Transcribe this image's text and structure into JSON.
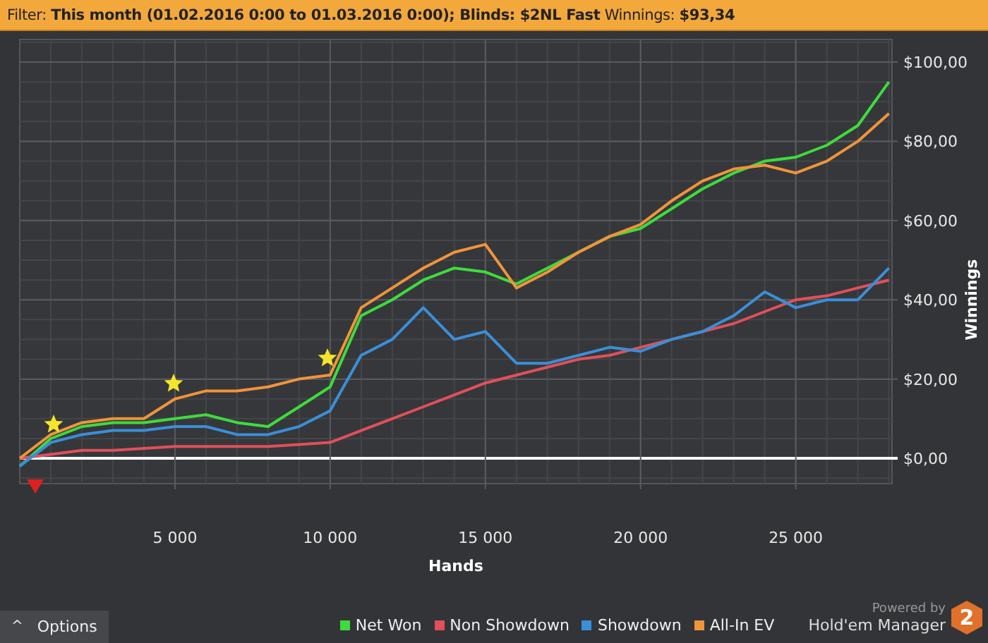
{
  "filter_bar": {
    "text": "Filter: **This month (01.02.2016 0:00 to 01.03.2016 0:00); Blinds: $2NL Fast** Winnings: **$93,34**"
  },
  "chart": {
    "chart_data": {
      "type": "line",
      "xlabel": "Hands",
      "ylabel": "Winnings",
      "x": [
        0,
        1000,
        2000,
        3000,
        4000,
        5000,
        6000,
        7000,
        8000,
        9000,
        10000,
        11000,
        12000,
        13000,
        14000,
        15000,
        16000,
        17000,
        18000,
        19000,
        20000,
        21000,
        22000,
        23000,
        24000,
        25000,
        26000,
        27000,
        28000
      ],
      "series": [
        {
          "name": "Net Won",
          "color": "#3ddc3d",
          "values": [
            -2,
            5,
            8,
            9,
            9,
            10,
            11,
            9,
            8,
            13,
            18,
            36,
            40,
            45,
            48,
            47,
            44,
            48,
            52,
            56,
            58,
            63,
            68,
            72,
            75,
            76,
            79,
            84,
            95
          ]
        },
        {
          "name": "Non Showdown",
          "color": "#e0505a",
          "values": [
            0,
            1,
            2,
            2,
            2.5,
            3,
            3,
            3,
            3,
            3.5,
            4,
            7,
            10,
            13,
            16,
            19,
            21,
            23,
            25,
            26,
            28,
            30,
            32,
            34,
            37,
            40,
            41,
            43,
            45
          ]
        },
        {
          "name": "Showdown",
          "color": "#3a8fd8",
          "values": [
            -2,
            4,
            6,
            7,
            7,
            8,
            8,
            6,
            6,
            8,
            12,
            26,
            30,
            38,
            30,
            32,
            24,
            24,
            26,
            28,
            27,
            30,
            32,
            36,
            42,
            38,
            40,
            40,
            48
          ]
        },
        {
          "name": "All-In EV",
          "color": "#f0943a",
          "values": [
            0,
            6,
            9,
            10,
            10,
            15,
            17,
            17,
            18,
            20,
            21,
            38,
            43,
            48,
            52,
            54,
            43,
            47,
            52,
            56,
            59,
            65,
            70,
            73,
            74,
            72,
            75,
            80,
            87
          ]
        }
      ],
      "xlim": [
        0,
        28100
      ],
      "ylim": [
        -6.4,
        105.7
      ],
      "xticks": [
        {
          "value": 5000,
          "label": "5 000"
        },
        {
          "value": 10000,
          "label": "10 000"
        },
        {
          "value": 15000,
          "label": "15 000"
        },
        {
          "value": 20000,
          "label": "20 000"
        },
        {
          "value": 25000,
          "label": "25 000"
        }
      ],
      "yticks": [
        {
          "value": 0,
          "label": "$0,00"
        },
        {
          "value": 20,
          "label": "$20,00"
        },
        {
          "value": 40,
          "label": "$40,00"
        },
        {
          "value": 60,
          "label": "$60,00"
        },
        {
          "value": 80,
          "label": "$80,00"
        },
        {
          "value": 100,
          "label": "$100,00"
        }
      ],
      "grid": true
    }
  },
  "footer": {
    "options_button": {
      "icon": "^",
      "label": "Options"
    },
    "powered_by": "Powered by",
    "brand": "Hold'em Manager",
    "logo": "2"
  }
}
